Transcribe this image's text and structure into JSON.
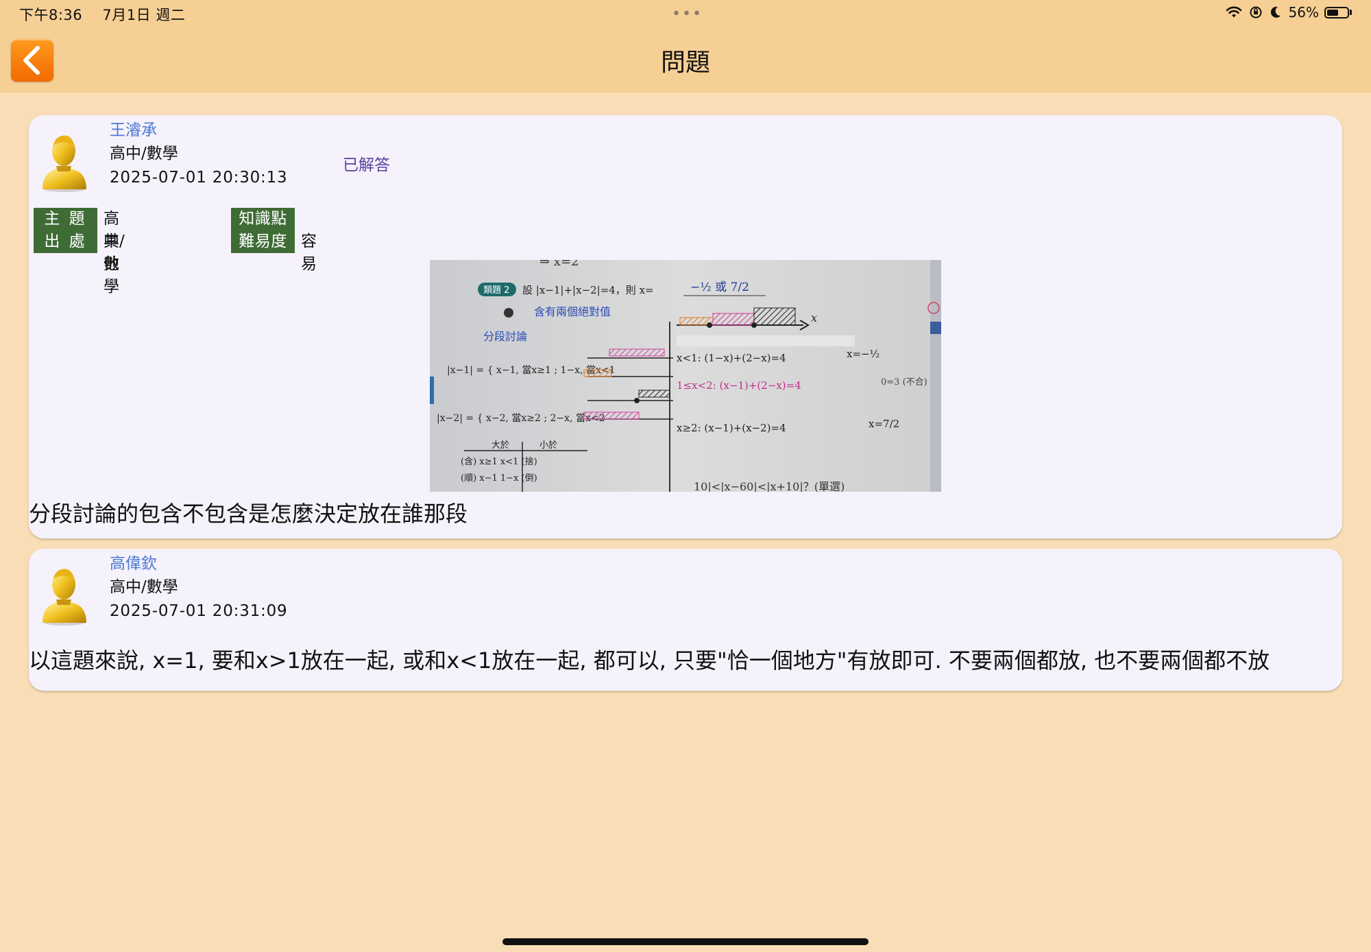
{
  "status_bar": {
    "time": "下午8:36",
    "date": "7月1日 週二",
    "battery": "56%",
    "battery_level": 0.56,
    "icons": [
      "wifi-icon",
      "orientation-lock-icon",
      "moon-icon",
      "battery-icon"
    ]
  },
  "nav": {
    "title": "問題",
    "back_icon": "chevron-left-icon"
  },
  "question": {
    "author": "王濬承",
    "subject": "高中/數學",
    "timestamp": "2025-07-01 20:30:13",
    "status": "已解答",
    "meta": {
      "topic_label": "主 題",
      "topic_value": "高中/數學",
      "source_label": "出 處",
      "source_value": "其他",
      "knowledge_label": "知識點",
      "knowledge_value": "",
      "difficulty_label": "難易度",
      "difficulty_value": "容易"
    },
    "photo": {
      "header_top": "⇒ x=2",
      "tag": "類題 2",
      "problem": "設 |x−1|+|x−2|=4，則 x=",
      "answer": "−½ 或 7/2",
      "hint": "含有兩個絕對值",
      "method": "分段討論",
      "piece1": "|x−1| = { x−1, 當x≥1 ; 1−x, 當x<1",
      "piece2": "|x−2| = { x−2, 當x≥2 ; 2−x, 當x<2",
      "case1": "x<1: (1−x)+(2−x)=4",
      "case1_result": "x=−½",
      "case2": "1≤x<2: (x−1)+(2−x)=4",
      "case2_result": "0=3 (不合)",
      "case3": "x≥2: (x−1)+(x−2)=4",
      "case3_result": "x=7/2",
      "table_head_left": "大於",
      "table_head_right": "小於",
      "table_row1": "(含) x≥1   x<1 (捨)",
      "table_row2": "(順) x−1   1−x (倒)",
      "footer": "10|<|x−60|<|x+10|？(單選)"
    },
    "text": "分段討論的包含不包含是怎麼決定放在誰那段"
  },
  "answer": {
    "author": "高偉欽",
    "subject": "高中/數學",
    "timestamp": "2025-07-01 20:31:09",
    "text": "以這題來說, x=1, 要和x>1放在一起, 或和x<1放在一起, 都可以, 只要\"恰一個地方\"有放即可. 不要兩個都放, 也不要兩個都不放"
  },
  "colors": {
    "nav_bar": "#f6cf94",
    "background": "#f8ddb7",
    "card": "#f6f2fb",
    "author": "#4b78d6",
    "status": "#5a3fa0",
    "tag": "#3f6b35",
    "back_button": "#f57a00"
  }
}
